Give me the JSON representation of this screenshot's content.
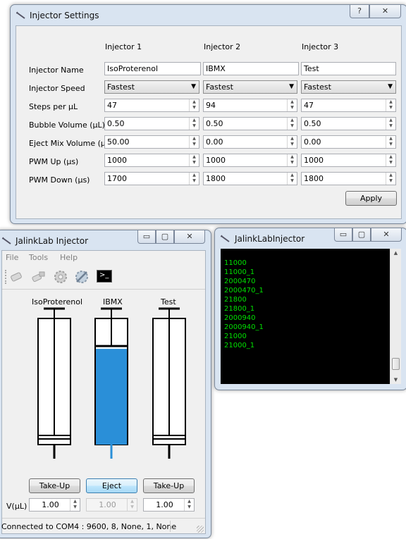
{
  "settings": {
    "title": "Injector Settings",
    "help_btn": "?",
    "close_btn": "✕",
    "columns": [
      "Injector 1",
      "Injector 2",
      "Injector 3"
    ],
    "rows": {
      "name": {
        "label": "Injector Name",
        "values": [
          "IsoProterenol",
          "IBMX",
          "Test"
        ]
      },
      "speed": {
        "label": "Injector Speed",
        "values": [
          "Fastest",
          "Fastest",
          "Fastest"
        ]
      },
      "steps": {
        "label": "Steps per µL",
        "values": [
          "47",
          "94",
          "47"
        ]
      },
      "bubble": {
        "label": "Bubble Volume (µL)",
        "values": [
          "0.50",
          "0.50",
          "0.50"
        ]
      },
      "eject": {
        "label": "Eject Mix Volume (µL)",
        "values": [
          "50.00",
          "0.00",
          "0.00"
        ]
      },
      "pwmup": {
        "label": "PWM Up (µs)",
        "values": [
          "1000",
          "1000",
          "1000"
        ]
      },
      "pwmdown": {
        "label": "PWM Down (µs)",
        "values": [
          "1700",
          "1800",
          "1800"
        ]
      }
    },
    "apply_label": "Apply"
  },
  "injector": {
    "title": "JalinkLab Injector",
    "minimize": "▭",
    "maximize": "▢",
    "close": "✕",
    "menu": [
      "File",
      "Tools",
      "Help"
    ],
    "toolbar_icons": [
      "connect-icon",
      "disconnect-icon",
      "settings-gear-icon",
      "advanced-settings-icon",
      "console-icon"
    ],
    "console_icon_text": ">_",
    "syringes": [
      {
        "name": "IsoProterenol",
        "button": "Take-Up",
        "volume": "1.00",
        "fill_fraction": 0.0,
        "enabled": true
      },
      {
        "name": "IBMX",
        "button": "Eject",
        "volume": "1.00",
        "fill_fraction": 0.77,
        "enabled": false
      },
      {
        "name": "Test",
        "button": "Take-Up",
        "volume": "1.00",
        "fill_fraction": 0.0,
        "enabled": true
      }
    ],
    "volume_label": "V(µL)",
    "status": "Connected to COM4 : 9600, 8, None, 1, None",
    "colors": {
      "fluid": "#2a8fd8"
    }
  },
  "console_window": {
    "title": "JalinkLabInjector",
    "minimize": "▭",
    "maximize": "▢",
    "close": "✕",
    "lines": [
      "11000",
      "11000_1",
      "2000470",
      "2000470_1",
      "21800",
      "21800_1",
      "2000940",
      "2000940_1",
      "21000",
      "21000_1"
    ],
    "colors": {
      "text": "#00e000",
      "background": "#000000"
    }
  }
}
